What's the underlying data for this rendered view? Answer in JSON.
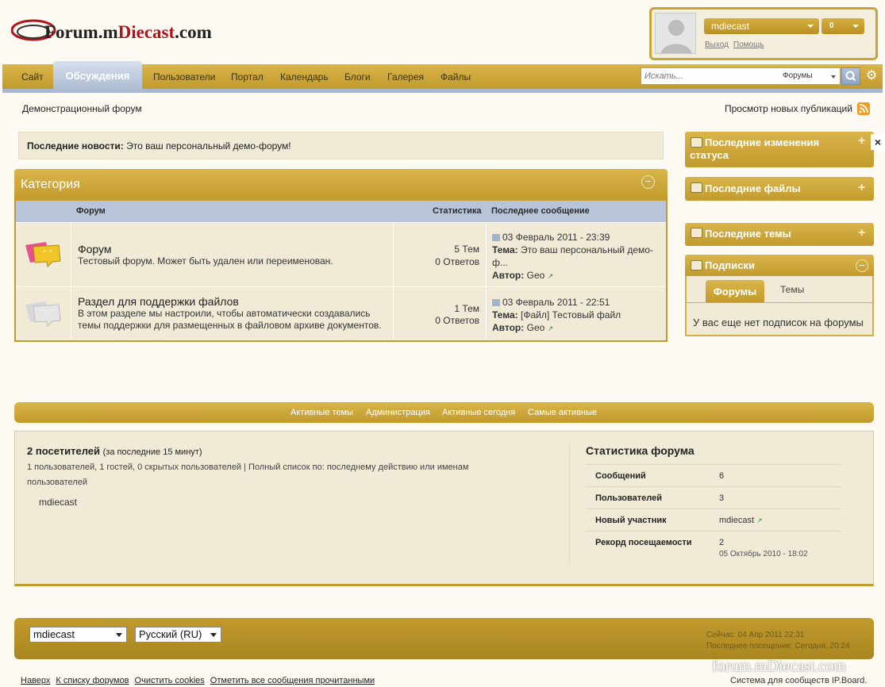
{
  "logo": {
    "prefix": "Forum.m",
    "red": "Diecast",
    "suffix": ".com"
  },
  "user": {
    "name": "mdiecast",
    "notifications": "0",
    "logout": "Выход",
    "help": "Помощь"
  },
  "nav": {
    "items": [
      "Сайт",
      "Обсуждения",
      "Пользователи",
      "Портал",
      "Календарь",
      "Блоги",
      "Галерея",
      "Файлы"
    ],
    "active_index": 1
  },
  "search": {
    "placeholder": "Искать...",
    "scope": "Форумы"
  },
  "breadcrumb": "Демонстрационный форум",
  "new_posts": "Просмотр новых публикаций",
  "news": {
    "label": "Последние новости:",
    "text": "Это ваш персональный демо-форум!"
  },
  "category": {
    "title": "Категория",
    "col_forum": "Форум",
    "col_stats": "Статистика",
    "col_last": "Последнее сообщение",
    "forums": [
      {
        "title": "Форум",
        "desc": "Тестовый форум. Может быть удален или переименован.",
        "topics": "5 Тем",
        "replies": "0 Ответов",
        "last_date": "03 Февраль 2011 - 23:39",
        "topic_label": "Тема:",
        "topic": "Это ваш персональный демо-ф...",
        "author_label": "Автор:",
        "author": "Geo"
      },
      {
        "title": "Раздел для поддержки файлов",
        "desc": "В этом разделе мы настроили, чтобы автоматически создавались темы поддержки для размещенных в файловом архиве документов.",
        "topics": "1 Тем",
        "replies": "0 Ответов",
        "last_date": "03 Февраль 2011 - 22:51",
        "topic_label": "Тема:",
        "topic": "[Файл] Тестовый файл",
        "author_label": "Автор:",
        "author": "Geo"
      }
    ]
  },
  "sidebar": {
    "status": "Последние изменения статуса",
    "files": "Последние файлы",
    "topics": "Последние темы",
    "subs": {
      "title": "Подписки",
      "tab_forums": "Форумы",
      "tab_topics": "Темы",
      "empty": "У вас еще нет подписок на форумы"
    }
  },
  "links_bar": [
    "Активные темы",
    "Администрация",
    "Активные сегодня",
    "Самые активные"
  ],
  "visitors": {
    "title": "2 посетителей",
    "period": "(за последние 15 минут)",
    "desc": "1 пользователей, 1 гостей, 0 скрытых пользователей | Полный список по: последнему действию или именам пользователей",
    "name": "mdiecast"
  },
  "forum_stats": {
    "title": "Статистика форума",
    "rows": [
      {
        "label": "Сообщений",
        "value": "6"
      },
      {
        "label": "Пользователей",
        "value": "3"
      },
      {
        "label": "Новый участник",
        "value": "mdiecast"
      },
      {
        "label": "Рекорд посещаемости",
        "value": "2",
        "sub": "05 Октябрь 2010 - 18:02"
      }
    ]
  },
  "bottom": {
    "skin": "mdiecast",
    "language": "Русский (RU)",
    "time_now": "Сейчас: 04 Апр 2011 22:31",
    "last_visit": "Последнее посещение: Сегодня, 20:24"
  },
  "footer_links": [
    "Наверх",
    "К списку форумов",
    "Очистить cookies",
    "Отметить все сообщения прочитанными"
  ],
  "powered": "Система для сообществ IP.Board.",
  "watermark": "forum.mDiecast.com",
  "colors": {
    "gold": "#c29a2d",
    "blue": "#a9b8cf",
    "cream": "#f1ead6"
  }
}
